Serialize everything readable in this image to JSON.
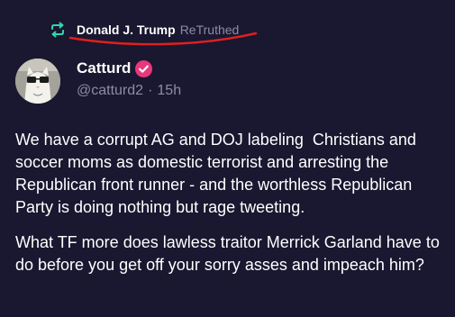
{
  "retruth": {
    "name": "Donald J. Trump",
    "suffix": "ReTruthed",
    "icon": "retruth-icon",
    "accent_color": "#32d6b2"
  },
  "author": {
    "display_name": "Catturd",
    "handle": "@catturd2",
    "separator": "·",
    "time_ago": "15h",
    "verified": true,
    "badge_color": "#e8387d",
    "avatar": "avatar"
  },
  "post": {
    "paragraphs": [
      "We have a corrupt AG and DOJ labeling  Christians and soccer moms as domestic terrorist and arresting the Republican front runner - and the worthless Republican Party is doing nothing but rage tweeting.",
      "What TF more does lawless traitor Merrick Garland have to do before you get off your sorry asses and impeach him?"
    ]
  },
  "colors": {
    "background": "#1a1730",
    "muted_text": "#8f8aa8",
    "annotation_underline": "#e0201f"
  }
}
